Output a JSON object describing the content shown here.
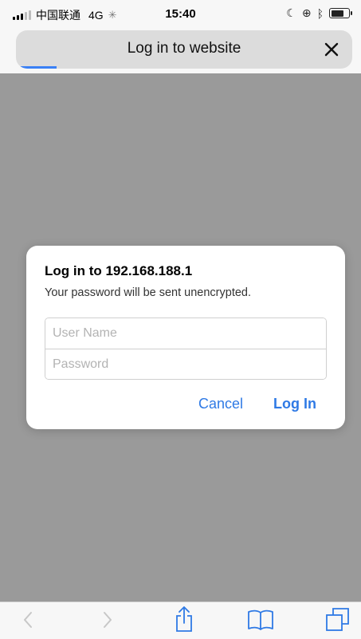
{
  "status_bar": {
    "carrier": "中国联通",
    "network": "4G",
    "time": "15:40"
  },
  "browser": {
    "address_title": "Log in to website",
    "load_progress_percent": 12
  },
  "dialog": {
    "title": "Log in to 192.168.188.1",
    "message": "Your password will be sent unencrypted.",
    "username_placeholder": "User Name",
    "username_value": "",
    "password_placeholder": "Password",
    "password_value": "",
    "cancel_label": "Cancel",
    "login_label": "Log In"
  },
  "toolbar": {
    "icons": [
      "back-icon",
      "forward-icon",
      "share-icon",
      "bookmarks-icon",
      "tabs-icon"
    ]
  },
  "colors": {
    "accent": "#2f7ae5",
    "progress": "#3a80f5",
    "dim_overlay": "#9a9a9a"
  }
}
